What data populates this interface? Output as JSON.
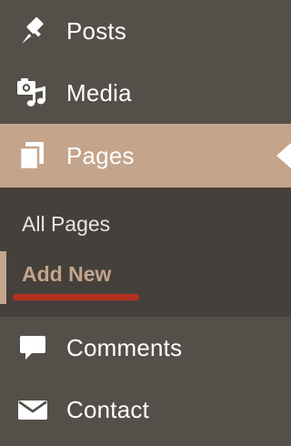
{
  "menu": {
    "items": [
      {
        "label": "Posts",
        "icon": "pin-icon"
      },
      {
        "label": "Media",
        "icon": "media-icon"
      },
      {
        "label": "Pages",
        "icon": "pages-icon",
        "current": true
      },
      {
        "label": "Comments",
        "icon": "comment-icon"
      },
      {
        "label": "Contact",
        "icon": "envelope-icon"
      }
    ],
    "pages_submenu": [
      {
        "label": "All Pages"
      },
      {
        "label": "Add New",
        "current": true
      }
    ]
  },
  "colors": {
    "sidebar_bg": "#544f49",
    "submenu_bg": "#45403b",
    "accent": "#c4a48b",
    "annotation_red": "#b5311f",
    "text": "#ffffff"
  }
}
